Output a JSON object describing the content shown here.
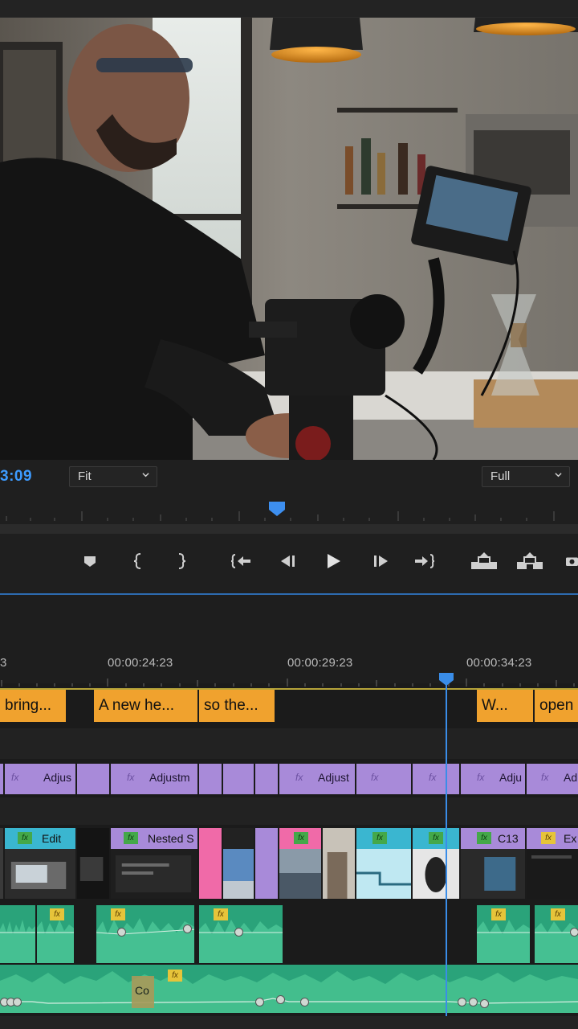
{
  "monitor": {
    "timecode": "3:09",
    "zoom_select": "Fit",
    "resolution_select": "Full",
    "scene_description_icon": "program-monitor-frame"
  },
  "transport": {
    "buttons": [
      "add-marker-icon",
      "mark-in-icon",
      "mark-out-icon",
      "go-to-in-icon",
      "step-back-icon",
      "play-icon",
      "step-forward-icon",
      "go-to-out-icon",
      "lift-icon",
      "extract-icon",
      "export-frame-icon"
    ]
  },
  "timeline": {
    "ruler_labels": [
      "3",
      "00:00:24:23",
      "00:00:29:23",
      "00:00:34:23"
    ],
    "captions": [
      "bring...",
      "A new he...",
      "so the...",
      "W...",
      "open"
    ],
    "adjustment_clips": [
      "Adjus",
      "Adjustm",
      "Adjust",
      "Adju",
      "Ad"
    ],
    "adjustment_fx": "fx",
    "video_clips": [
      "Edit",
      "Nested S",
      "C13",
      "Ex"
    ],
    "audio_clip_label": "Co",
    "audio_fx": "fx"
  },
  "colors": {
    "accent": "#3d9bff",
    "caption": "#f0a22e",
    "adjustment": "#a88ad9",
    "audio": "#2aa37a",
    "video_teal": "#3ab6d0",
    "video_pink": "#f06aa8"
  }
}
